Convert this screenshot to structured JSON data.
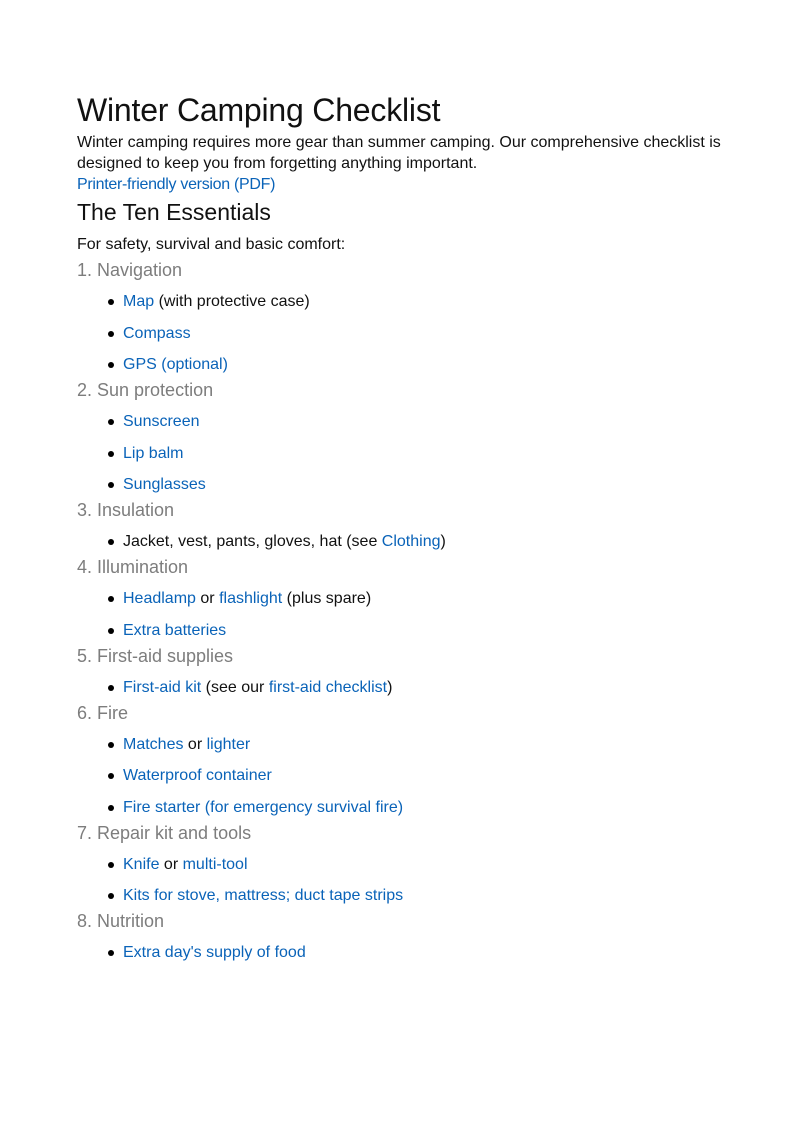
{
  "colors": {
    "link": "#0a63b8",
    "section_heading": "#7d7d7d",
    "text": "#111111"
  },
  "title": "Winter Camping Checklist",
  "intro": "Winter camping requires more gear than summer camping. Our comprehensive checklist is designed to keep you from forgetting anything important.",
  "pdf_link": "Printer-friendly version (PDF)",
  "subheading": "The Ten Essentials",
  "lead": "For safety, survival and basic comfort:",
  "sections": [
    {
      "heading": "1. Navigation",
      "items": [
        [
          {
            "t": "Map",
            "link": true
          },
          {
            "t": " (with protective case)",
            "link": false
          }
        ],
        [
          {
            "t": "Compass",
            "link": true
          }
        ],
        [
          {
            "t": "GPS (optional)",
            "link": true
          }
        ]
      ]
    },
    {
      "heading": "2. Sun protection",
      "items": [
        [
          {
            "t": "Sunscreen",
            "link": true
          }
        ],
        [
          {
            "t": "Lip balm",
            "link": true
          }
        ],
        [
          {
            "t": "Sunglasses",
            "link": true
          }
        ]
      ]
    },
    {
      "heading": "3. Insulation",
      "items": [
        [
          {
            "t": "Jacket, vest, pants, gloves, hat (see ",
            "link": false
          },
          {
            "t": "Clothing",
            "link": true
          },
          {
            "t": ")",
            "link": false
          }
        ]
      ]
    },
    {
      "heading": "4. Illumination",
      "items": [
        [
          {
            "t": "Headlamp",
            "link": true
          },
          {
            "t": " or ",
            "link": false
          },
          {
            "t": "flashlight",
            "link": true
          },
          {
            "t": " (plus spare)",
            "link": false
          }
        ],
        [
          {
            "t": "Extra batteries",
            "link": true
          }
        ]
      ]
    },
    {
      "heading": "5. First-aid supplies",
      "items": [
        [
          {
            "t": "First-aid kit",
            "link": true
          },
          {
            "t": " (see our ",
            "link": false
          },
          {
            "t": "first-aid checklist",
            "link": true
          },
          {
            "t": ")",
            "link": false
          }
        ]
      ]
    },
    {
      "heading": "6. Fire",
      "items": [
        [
          {
            "t": "Matches",
            "link": true
          },
          {
            "t": " or ",
            "link": false
          },
          {
            "t": "lighter",
            "link": true
          }
        ],
        [
          {
            "t": "Waterproof container",
            "link": true
          }
        ],
        [
          {
            "t": "Fire starter (for emergency survival fire)",
            "link": true
          }
        ]
      ]
    },
    {
      "heading": "7. Repair kit and tools",
      "items": [
        [
          {
            "t": "Knife",
            "link": true
          },
          {
            "t": " or ",
            "link": false
          },
          {
            "t": "multi-tool",
            "link": true
          }
        ],
        [
          {
            "t": "Kits for stove, mattress; duct tape strips",
            "link": true
          }
        ]
      ]
    },
    {
      "heading": "8. Nutrition",
      "items": [
        [
          {
            "t": "Extra day's supply of food",
            "link": true
          }
        ]
      ]
    }
  ]
}
